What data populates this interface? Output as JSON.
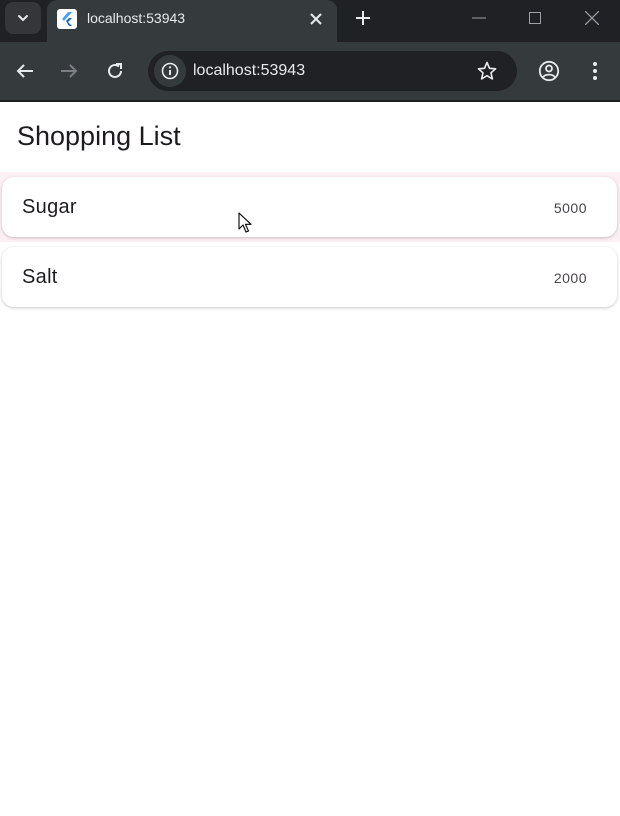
{
  "browser": {
    "tab_title": "localhost:53943",
    "url": "localhost:53943",
    "colors": {
      "tab_bg": "#353b3c",
      "strip_bg": "#202124",
      "text": "#e8eaed"
    }
  },
  "app": {
    "title": "Shopping List",
    "items": [
      {
        "name": "Sugar",
        "quantity": "5000"
      },
      {
        "name": "Salt",
        "quantity": "2000"
      }
    ],
    "colors": {
      "hover": "#fdf0f4",
      "text": "#1d1b20",
      "secondary": "#49454f"
    }
  },
  "icons": [
    "tab-search-icon",
    "flutter-favicon-icon",
    "close-icon",
    "plus-icon",
    "minimize-icon",
    "maximize-icon",
    "window-close-icon",
    "back-arrow-icon",
    "forward-arrow-icon",
    "reload-icon",
    "site-info-icon",
    "star-icon",
    "profile-icon",
    "menu-dots-icon",
    "mouse-cursor-icon"
  ]
}
